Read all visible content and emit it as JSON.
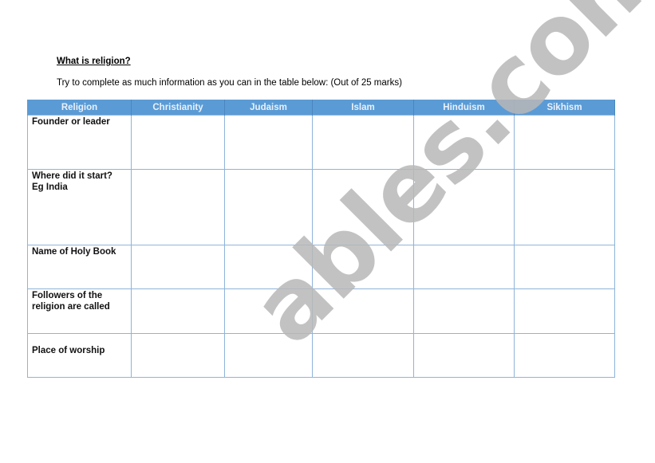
{
  "title": "What is religion?",
  "instructions": "Try to complete as much information as you can in the table below: (Out of 25 marks)",
  "table": {
    "headers": [
      "Religion",
      "Christianity",
      "Judaism",
      "Islam",
      "Hinduism",
      "Sikhism"
    ],
    "rows": [
      {
        "label_line1": "Founder or leader",
        "label_line2": ""
      },
      {
        "label_line1": "Where did it start?",
        "label_line2": "Eg India"
      },
      {
        "label_line1": "Name of Holy Book",
        "label_line2": ""
      },
      {
        "label_line1": "Followers of the",
        "label_line2": "religion are called"
      },
      {
        "label_line1": "Place of worship",
        "label_line2": ""
      }
    ]
  },
  "colors": {
    "header_bg": "#5b9bd5",
    "header_text": "#e8f1fb",
    "border": "#8fb4d9",
    "watermark": "#b8b8b8"
  },
  "watermark": "ables.com"
}
